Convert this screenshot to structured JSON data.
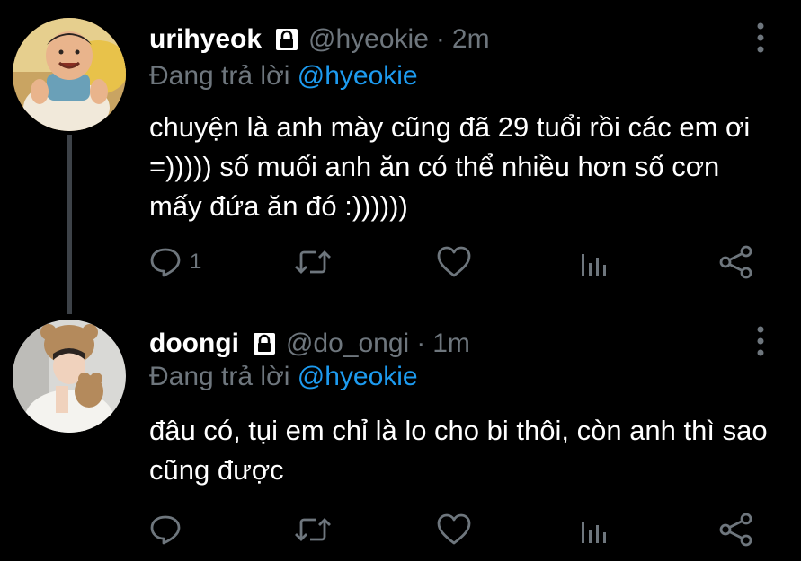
{
  "tweets": [
    {
      "display_name": "urihyeok",
      "handle": "@hyeokie",
      "separator": "·",
      "time": "2m",
      "reply_prefix": "Đang trả lời",
      "reply_to": "@hyeokie",
      "text": "chuyện là anh mày cũng đã 29 tuổi rồi các em ơi =))))) số muối anh ăn có thể nhiều hơn số cơn mấy đứa ăn đó :))))))",
      "reply_count": "1"
    },
    {
      "display_name": "doongi",
      "handle": "@do_ongi",
      "separator": "·",
      "time": "1m",
      "reply_prefix": "Đang trả lời",
      "reply_to": "@hyeokie",
      "text": "đâu có, tụi em chỉ là lo cho bi thôi, còn anh thì sao cũng được",
      "reply_count": ""
    }
  ],
  "icons": {
    "lock": "lock-icon",
    "more": "more-vertical-icon",
    "reply": "reply-icon",
    "retweet": "retweet-icon",
    "like": "heart-icon",
    "analytics": "analytics-icon",
    "share": "share-icon"
  },
  "colors": {
    "background": "#000000",
    "text": "#ffffff",
    "secondary": "#6e767d",
    "mention": "#1d9bf0",
    "thread_line": "#3d4248"
  }
}
